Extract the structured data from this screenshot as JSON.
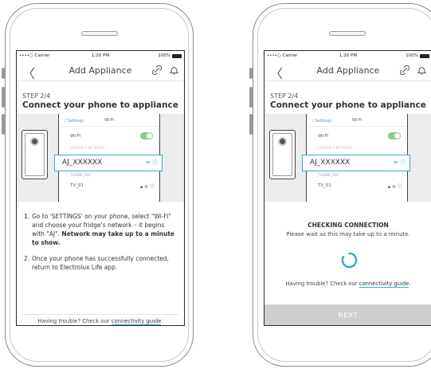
{
  "status": {
    "carrier": "••••○ Carrier",
    "time": "1:20 PM",
    "battery": "100%"
  },
  "header": {
    "back_glyph": "〈",
    "title": "Add Appliance"
  },
  "step": {
    "label": "STEP 2/4",
    "title": "Connect your phone to appliance"
  },
  "illustration": {
    "settings_back": "〈 Settings",
    "settings_title": "Wi-Fi",
    "wifi_label": "Wi-Fi",
    "section_label": "CHOOSE A NETWORK...",
    "network": "AJ_XXXXXX",
    "faint_network": "TVABBB_500",
    "other_network": "TV_01"
  },
  "instructions": [
    {
      "num": "1.",
      "text": "Go to 'SETTINGS' on your phone, select \"Wi-Fi\" and choose your fridge's network – it begins with \"AJ\".",
      "bold": "Network may take up to a minute to show."
    },
    {
      "num": "2.",
      "text": "Once your phone has successfully connected, return to Electrolux Life app.",
      "bold": ""
    }
  ],
  "help": {
    "prefix": "Having trouble? Check our ",
    "link": "connectivity guide",
    "suffix": "."
  },
  "checking": {
    "title": "CHECKING CONNECTION",
    "message": "Please wait as this may take up to a minute."
  },
  "next_label": "NEXT",
  "colors": {
    "accent": "#3fa9c7",
    "toggle_on": "#8bc98f",
    "button_disabled": "#cfcfcf"
  }
}
